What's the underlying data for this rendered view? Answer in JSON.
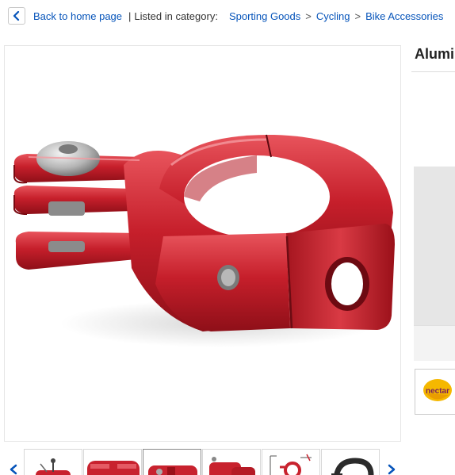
{
  "breadcrumb": {
    "back_label": "Back to home page",
    "separator": "|",
    "listed_label": "Listed in category:",
    "categories": [
      "Sporting Goods",
      "Cycling",
      "Bike Accessories"
    ],
    "arrow": ">"
  },
  "product": {
    "title": "Alumi",
    "image_alt": "Red aluminium handlebar clamp mount"
  },
  "rewards": {
    "badge_text": "nectar"
  },
  "thumbnails": {
    "count": 6,
    "selected_index": 2
  },
  "colors": {
    "link": "#0654ba",
    "product_red": "#c8222e",
    "nectar_yellow": "#f5b800"
  },
  "icons": {
    "back": "chevron-left-icon",
    "thumb_prev": "chevron-left-icon",
    "thumb_next": "chevron-right-icon"
  }
}
